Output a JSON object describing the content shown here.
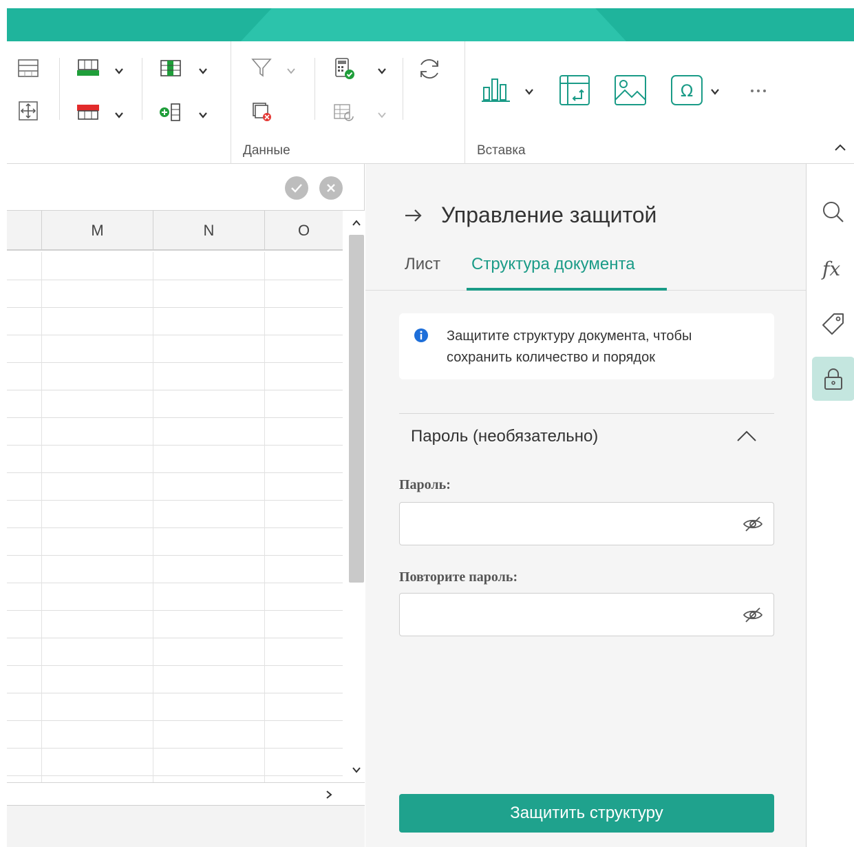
{
  "ribbon": {
    "groups": [
      {
        "label": "Данные"
      },
      {
        "label": "Вставка"
      }
    ]
  },
  "formula_bar": {
    "confirm_icon": "check-circle-icon",
    "cancel_icon": "x-circle-icon"
  },
  "sheet": {
    "columns": [
      "M",
      "N",
      "O"
    ]
  },
  "panel": {
    "title": "Управление защитой",
    "back_icon": "arrow-right-icon",
    "tabs": [
      {
        "label": "Лист",
        "active": false
      },
      {
        "label": "Структура документа",
        "active": true
      }
    ],
    "info": "Защитите структуру документа, чтобы сохранить количество и порядок",
    "password_section": "Пароль (необязательно)",
    "password_label": "Пароль:",
    "repeat_label": "Повторите пароль:",
    "password_value": "",
    "repeat_value": "",
    "protect_button": "Защитить структуру"
  },
  "sidebar_icons": [
    "search-icon",
    "function-icon",
    "tag-icon",
    "lock-icon"
  ],
  "colors": {
    "accent": "#1fa28d",
    "topbar": "#1fb49c",
    "active_tab": "#1a9b87",
    "strip_active": "#c4e6df"
  }
}
